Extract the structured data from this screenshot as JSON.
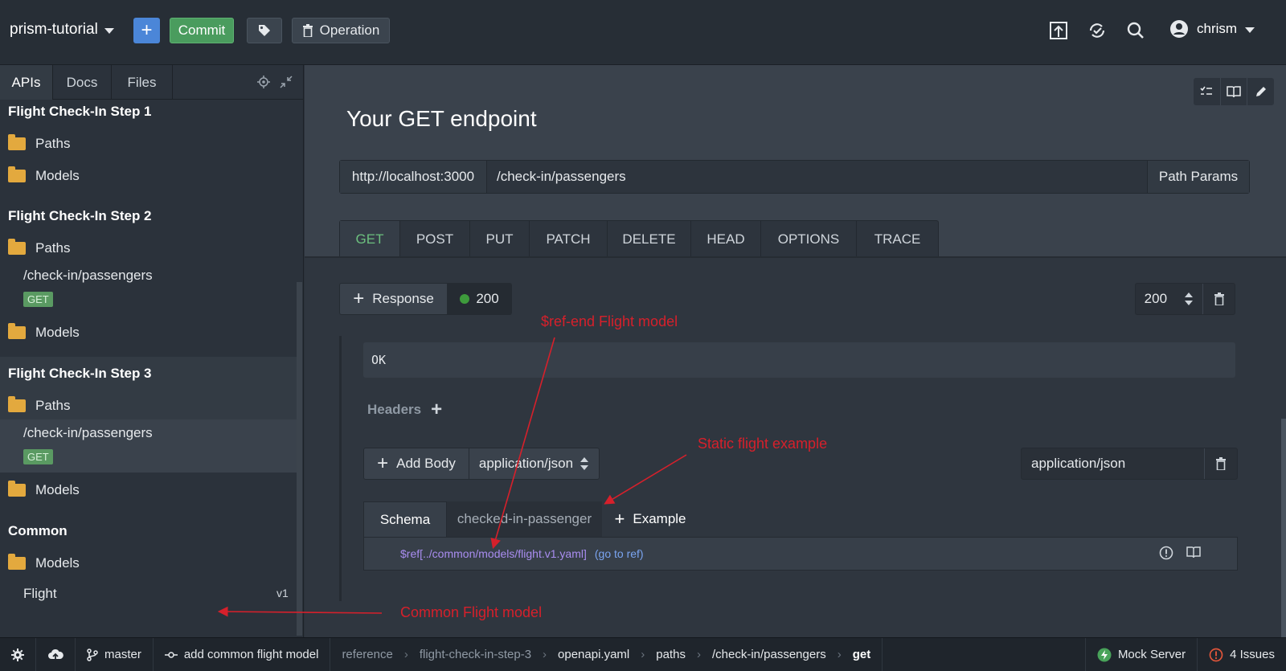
{
  "topbar": {
    "project": "prism-tutorial",
    "commit_label": "Commit",
    "operation_label": "Operation",
    "user": "chrism",
    "icons": [
      "plus-icon",
      "tag-icon",
      "trash-icon",
      "publish-icon",
      "sync-icon",
      "search-icon",
      "user-icon"
    ]
  },
  "sidebar": {
    "tabs": [
      "APIs",
      "Docs",
      "Files"
    ],
    "groups": [
      {
        "title": "Flight Check-In Step 1",
        "paths": "Paths",
        "models": "Models"
      },
      {
        "title": "Flight Check-In Step 2",
        "paths": "Paths",
        "path_item": "/check-in/passengers",
        "method": "GET",
        "models": "Models"
      },
      {
        "title": "Flight Check-In Step 3",
        "paths": "Paths",
        "path_item": "/check-in/passengers",
        "method": "GET",
        "models": "Models"
      },
      {
        "title": "Common",
        "models": "Models",
        "model_item": "Flight",
        "version": "v1"
      }
    ]
  },
  "main": {
    "title": "Your GET endpoint",
    "url_host": "http://localhost:3000",
    "url_path": "/check-in/passengers",
    "path_params": "Path Params",
    "methods": [
      "GET",
      "POST",
      "PUT",
      "PATCH",
      "DELETE",
      "HEAD",
      "OPTIONS",
      "TRACE"
    ],
    "active_method": "GET",
    "response_label": "Response",
    "response_code": "200",
    "code_select": "200",
    "description": "OK",
    "headers_label": "Headers",
    "add_body_label": "Add Body",
    "body_type": "application/json",
    "content_type": "application/json",
    "body_tabs": [
      "Schema",
      "checked-in-passenger",
      "Example"
    ],
    "schema_ref": "$ref[../common/models/flight.v1.yaml]",
    "goto_ref": "(go to ref)"
  },
  "annotations": {
    "ref_end": "$ref-end Flight model",
    "static_example": "Static flight example",
    "common_model": "Common Flight model",
    "color": "#d6202b"
  },
  "statusbar": {
    "branch": "master",
    "commit": "add common flight model",
    "crumbs": [
      "reference",
      "flight-check-in-step-3",
      "openapi.yaml",
      "paths",
      "/check-in/passengers",
      "get"
    ],
    "mock_server": "Mock Server",
    "issues": "4 Issues"
  },
  "colors": {
    "accent_blue": "#4b86d8",
    "commit_green": "#4a9c5e",
    "get_green": "#6cbf7e",
    "folder": "#e3a93e",
    "ref_purple": "#a98df0"
  }
}
